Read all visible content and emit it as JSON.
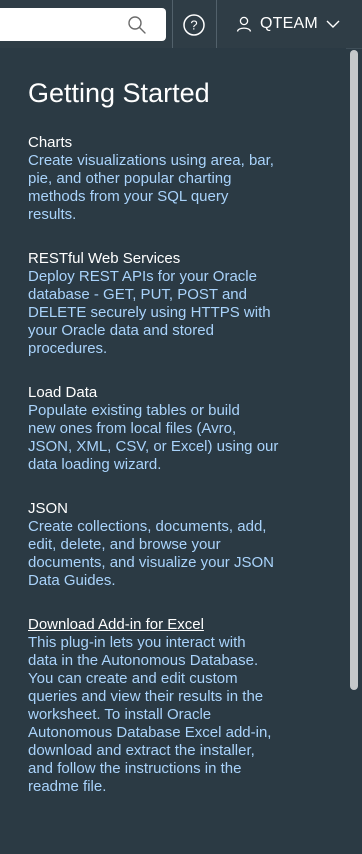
{
  "header": {
    "search": {
      "placeholder": "",
      "value": ""
    },
    "help_label": "?",
    "user": {
      "name": "QTEAM"
    }
  },
  "panel": {
    "title": "Getting Started",
    "sections": [
      {
        "title": "Charts",
        "description": "Create visualizations using area, bar,\npie, and other popular charting\nmethods from your SQL query\nresults."
      },
      {
        "title": "RESTful Web Services",
        "description": "Deploy REST APIs for your Oracle\ndatabase - GET, PUT, POST and\nDELETE securely using HTTPS with\nyour Oracle data and stored\nprocedures."
      },
      {
        "title": "Load Data",
        "description": "Populate existing tables or build\nnew ones from local files (Avro,\nJSON, XML, CSV, or Excel) using our\ndata loading wizard."
      },
      {
        "title": "JSON",
        "description": "Create collections, documents, add,\nedit, delete, and browse your\ndocuments, and visualize your JSON\nData Guides."
      },
      {
        "title": "Download Add-in for Excel",
        "description": "This plug-in lets you interact with\ndata in the Autonomous Database.\nYou can create and edit custom\nqueries and view their results in the\nworksheet. To install Oracle\nAutonomous Database Excel add-in,\ndownload and extract the installer,\nand follow the instructions in the\nreadme file."
      }
    ]
  },
  "colors": {
    "background": "#2b3a44",
    "description_text": "#a9d3fb",
    "title_text": "#ffffff"
  },
  "icons": [
    "search-icon",
    "help-icon",
    "user-icon",
    "chevron-down-icon"
  ]
}
